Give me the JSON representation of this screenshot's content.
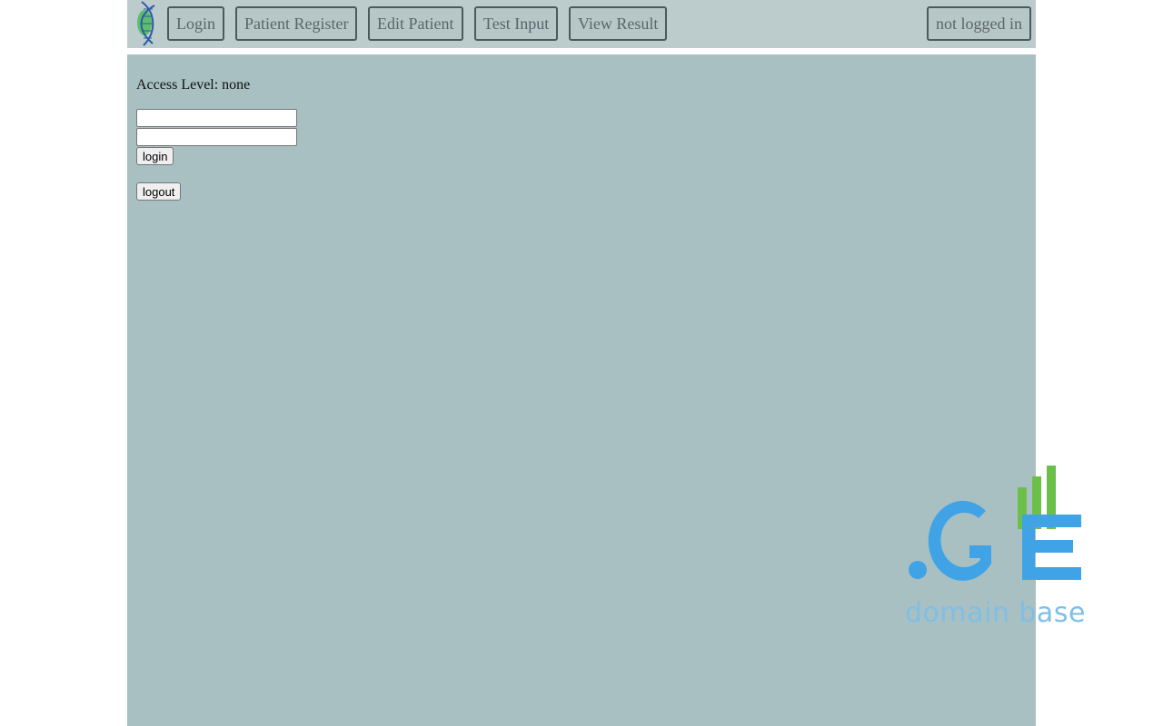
{
  "nav": {
    "logo_icon": "dna-helix-icon",
    "items": [
      {
        "label": "Login"
      },
      {
        "label": "Patient Register"
      },
      {
        "label": "Edit Patient"
      },
      {
        "label": "Test Input"
      },
      {
        "label": "View Result"
      }
    ],
    "status_label": "not logged in"
  },
  "main": {
    "access_level": "Access Level: none",
    "username_value": "",
    "password_value": "",
    "login_label": "login",
    "logout_label": "logout"
  },
  "watermark": {
    "brand": ".GE",
    "tagline": "domain base",
    "colors": {
      "blue": "#3fa3e6",
      "green": "#6cc04a",
      "text": "#7fbfe6"
    }
  },
  "colors": {
    "navbar_bg": "#bccbcc",
    "panel_bg": "#a8c0c2"
  }
}
